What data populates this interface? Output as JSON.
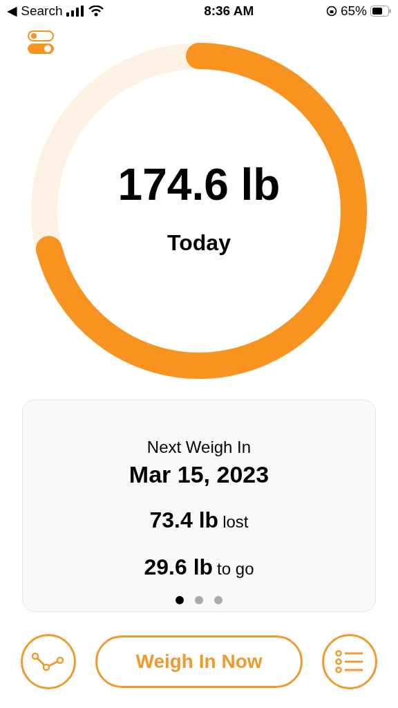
{
  "status_bar": {
    "back": "◀ Search",
    "time": "8:36 AM",
    "battery": "65%"
  },
  "progress": {
    "level": 0.71,
    "value": "174.6 lb",
    "label": "Today"
  },
  "card": {
    "title": "Next Weigh In",
    "date": "Mar 15, 2023",
    "stats": [
      {
        "value": "73.4 lb",
        "unit": "lost"
      },
      {
        "value": "29.6 lb",
        "unit": "to go"
      }
    ],
    "pages": [
      {
        "selected": true
      },
      {
        "selected": false
      },
      {
        "selected": false
      }
    ]
  },
  "actions": {
    "primary": "Weigh In Now"
  }
}
